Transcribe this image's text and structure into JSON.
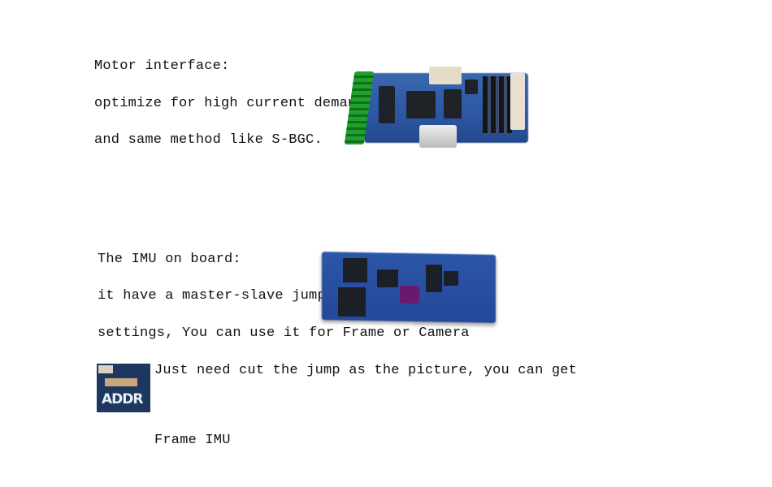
{
  "motor_section": {
    "lines": [
      "Motor interface:",
      "optimize for high current demand",
      "and same method like S-BGC."
    ],
    "image_alt": "motor controller board photo"
  },
  "imu_section": {
    "lines": [
      "The IMU on board:",
      "it have a master-slave jumper",
      "settings, You can use it for Frame or Camera",
      "Just need cut the jump as the picture, you can get",
      "Frame IMU"
    ],
    "image_alt": "IMU board photo",
    "jumper_thumbnail": {
      "label": "ADDR",
      "alt": "ADDR jumper close-up"
    }
  }
}
